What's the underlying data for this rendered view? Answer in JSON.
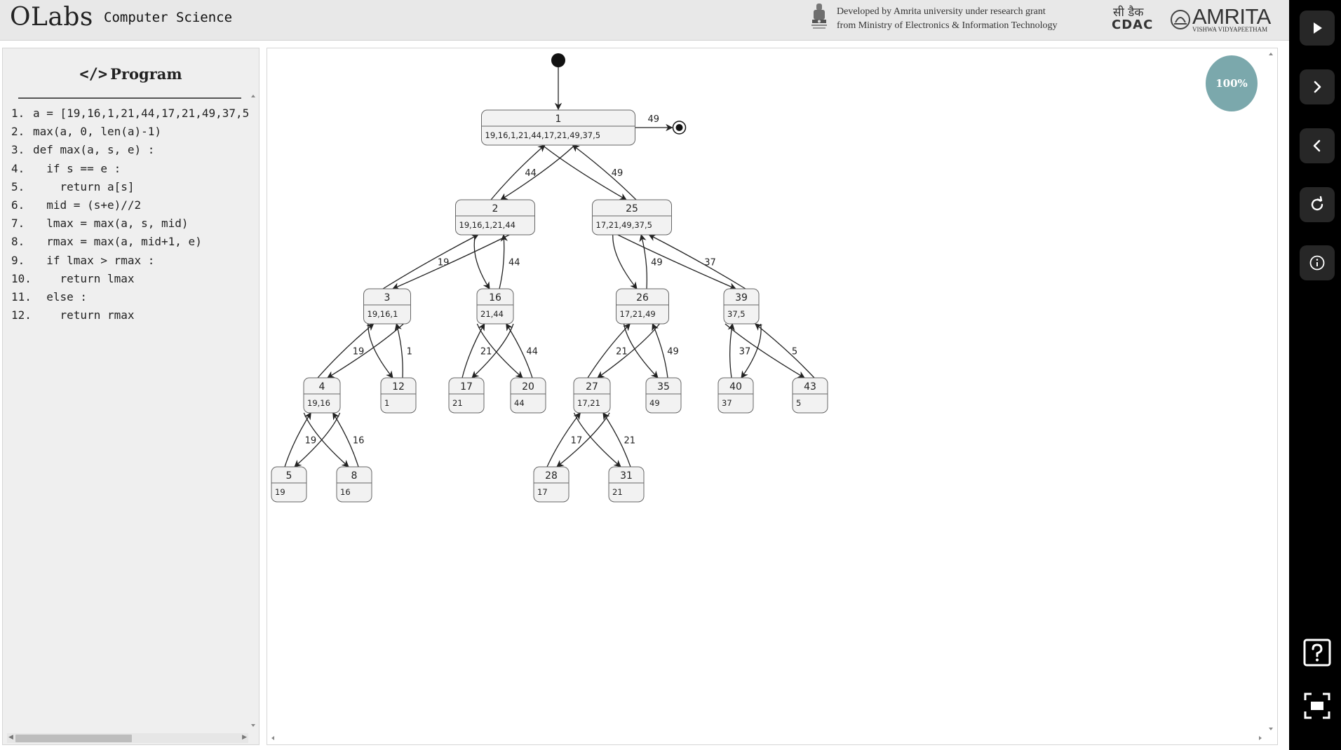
{
  "header": {
    "logo": "OLabs",
    "subject": "Computer Science",
    "credit_line1": "Developed by Amrita university under research grant",
    "credit_line2": "from Ministry of Electronics & Information Technology",
    "cdac_top": "सी डैक",
    "cdac_bottom": "CDAC",
    "amrita_name": "AMRITA",
    "amrita_sub": "VISHWA VIDYAPEETHAM"
  },
  "program": {
    "title": "Program",
    "lines": [
      {
        "num": "1.",
        "text": "a = [19,16,1,21,44,17,21,49,37,5"
      },
      {
        "num": "2.",
        "text": "max(a, 0, len(a)-1)"
      },
      {
        "num": "3.",
        "text": "def max(a, s, e) :"
      },
      {
        "num": "4.",
        "text": "  if s == e :"
      },
      {
        "num": "5.",
        "text": "    return a[s]"
      },
      {
        "num": "6.",
        "text": "  mid = (s+e)//2"
      },
      {
        "num": "7.",
        "text": "  lmax = max(a, s, mid)"
      },
      {
        "num": "8.",
        "text": "  rmax = max(a, mid+1, e)"
      },
      {
        "num": "9.",
        "text": "  if lmax > rmax :"
      },
      {
        "num": "10.",
        "text": "    return lmax"
      },
      {
        "num": "11.",
        "text": "  else :"
      },
      {
        "num": "12.",
        "text": "    return rmax"
      }
    ]
  },
  "zoom_level": "100%",
  "toolbar": {
    "buttons": [
      "play-icon",
      "next-icon",
      "previous-icon",
      "reset-icon",
      "info-icon",
      "help-icon",
      "fullscreen-icon"
    ]
  },
  "recursion_tree": {
    "states": [
      {
        "id": "1",
        "values": "19,16,1,21,44,17,21,49,37,5"
      },
      {
        "id": "2",
        "values": "19,16,1,21,44"
      },
      {
        "id": "25",
        "values": "17,21,49,37,5"
      },
      {
        "id": "3",
        "values": "19,16,1"
      },
      {
        "id": "16",
        "values": "21,44"
      },
      {
        "id": "26",
        "values": "17,21,49"
      },
      {
        "id": "39",
        "values": "37,5"
      },
      {
        "id": "4",
        "values": "19,16"
      },
      {
        "id": "12",
        "values": "1"
      },
      {
        "id": "17",
        "values": "21"
      },
      {
        "id": "20",
        "values": "44"
      },
      {
        "id": "27",
        "values": "17,21"
      },
      {
        "id": "35",
        "values": "49"
      },
      {
        "id": "40",
        "values": "37"
      },
      {
        "id": "43",
        "values": "5"
      },
      {
        "id": "5",
        "values": "19"
      },
      {
        "id": "8",
        "values": "16"
      },
      {
        "id": "28",
        "values": "17"
      },
      {
        "id": "31",
        "values": "21"
      }
    ],
    "calls": [
      {
        "from": "1",
        "to": "2"
      },
      {
        "from": "1",
        "to": "25"
      },
      {
        "from": "2",
        "to": "3"
      },
      {
        "from": "2",
        "to": "16"
      },
      {
        "from": "25",
        "to": "26"
      },
      {
        "from": "25",
        "to": "39"
      },
      {
        "from": "3",
        "to": "4"
      },
      {
        "from": "3",
        "to": "12"
      },
      {
        "from": "16",
        "to": "17"
      },
      {
        "from": "16",
        "to": "20"
      },
      {
        "from": "26",
        "to": "27"
      },
      {
        "from": "26",
        "to": "35"
      },
      {
        "from": "39",
        "to": "40"
      },
      {
        "from": "39",
        "to": "43"
      },
      {
        "from": "4",
        "to": "5"
      },
      {
        "from": "4",
        "to": "8"
      },
      {
        "from": "27",
        "to": "28"
      },
      {
        "from": "27",
        "to": "31"
      }
    ],
    "returns": [
      {
        "from": "2",
        "to": "1",
        "value": "44"
      },
      {
        "from": "25",
        "to": "1",
        "value": "49"
      },
      {
        "from": "3",
        "to": "2",
        "value": "19"
      },
      {
        "from": "16",
        "to": "2",
        "value": "44"
      },
      {
        "from": "26",
        "to": "25",
        "value": "49"
      },
      {
        "from": "39",
        "to": "25",
        "value": "37"
      },
      {
        "from": "4",
        "to": "3",
        "value": "19"
      },
      {
        "from": "12",
        "to": "3",
        "value": "1"
      },
      {
        "from": "17",
        "to": "16",
        "value": "21"
      },
      {
        "from": "20",
        "to": "16",
        "value": "44"
      },
      {
        "from": "27",
        "to": "26",
        "value": "21"
      },
      {
        "from": "35",
        "to": "26",
        "value": "49"
      },
      {
        "from": "40",
        "to": "39",
        "value": "37"
      },
      {
        "from": "43",
        "to": "39",
        "value": "5"
      },
      {
        "from": "5",
        "to": "4",
        "value": "19"
      },
      {
        "from": "8",
        "to": "4",
        "value": "16"
      },
      {
        "from": "28",
        "to": "27",
        "value": "17"
      },
      {
        "from": "31",
        "to": "27",
        "value": "21"
      }
    ],
    "final_result": "49"
  }
}
